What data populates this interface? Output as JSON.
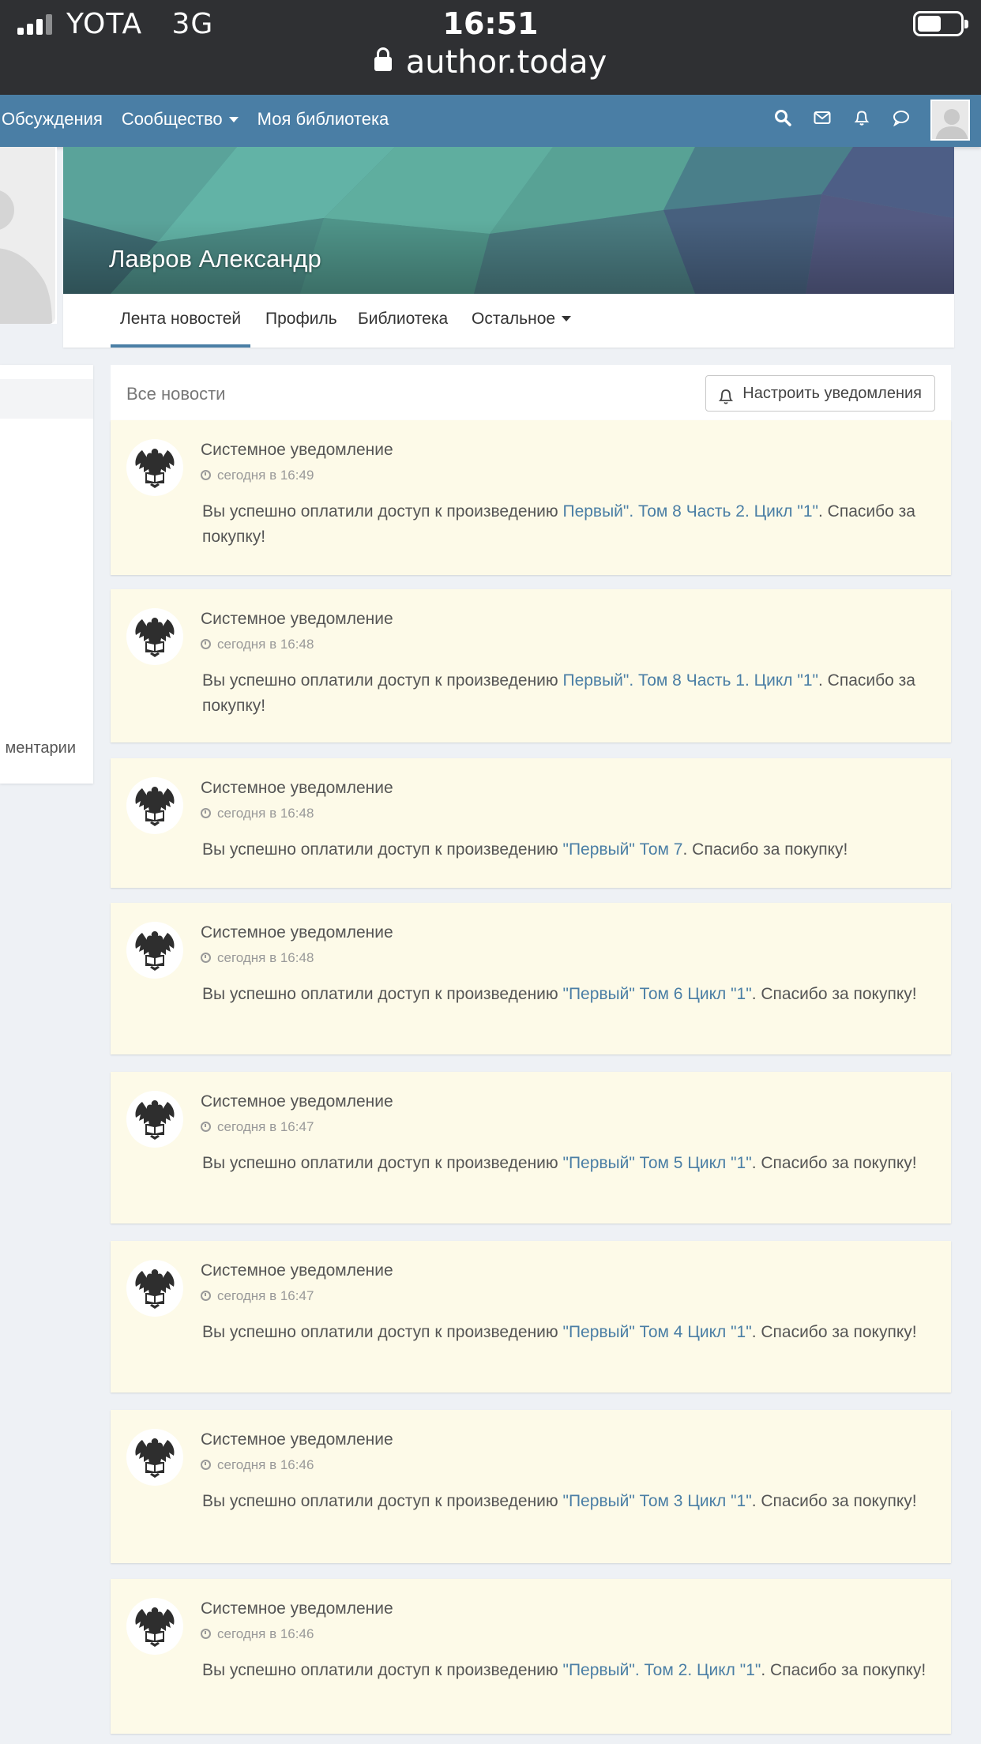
{
  "status_bar": {
    "carrier": "YOTA",
    "network": "3G",
    "time": "16:51",
    "url": "author.today"
  },
  "nav": {
    "links": [
      "Обсуждения",
      "Сообщество",
      "Моя библиотека"
    ]
  },
  "profile": {
    "name": "Лавров Александр",
    "tabs": [
      "Лента новостей",
      "Профиль",
      "Библиотека",
      "Остальное"
    ],
    "active_tab": "Лента новостей"
  },
  "left_panel": {
    "comments_label": "ментарии"
  },
  "feed": {
    "title": "Все новости",
    "notify_button": "Настроить уведомления",
    "items": [
      {
        "author": "Системное уведомление",
        "time": "сегодня в 16:49",
        "prefix": "Вы успешно оплатили доступ к произведению ",
        "link": "Первый\". Том 8 Часть 2. Цикл \"1\"",
        "suffix": ". Спасибо за покупку!"
      },
      {
        "author": "Системное уведомление",
        "time": "сегодня в 16:48",
        "prefix": "Вы успешно оплатили доступ к произведению ",
        "link": "Первый\". Том 8 Часть 1. Цикл \"1\"",
        "suffix": ". Спасибо за покупку!"
      },
      {
        "author": "Системное уведомление",
        "time": "сегодня в 16:48",
        "prefix": "Вы успешно оплатили доступ к произведению ",
        "link": "\"Первый\" Том 7",
        "suffix": ". Спасибо за покупку!"
      },
      {
        "author": "Системное уведомление",
        "time": "сегодня в 16:48",
        "prefix": "Вы успешно оплатили доступ к произведению ",
        "link": "\"Первый\" Том 6 Цикл \"1\"",
        "suffix": ". Спасибо за покупку!"
      },
      {
        "author": "Системное уведомление",
        "time": "сегодня в 16:47",
        "prefix": "Вы успешно оплатили доступ к произведению ",
        "link": "\"Первый\" Том 5 Цикл \"1\"",
        "suffix": ". Спасибо за покупку!"
      },
      {
        "author": "Системное уведомление",
        "time": "сегодня в 16:47",
        "prefix": "Вы успешно оплатили доступ к произведению ",
        "link": "\"Первый\" Том 4 Цикл \"1\"",
        "suffix": ". Спасибо за покупку!"
      },
      {
        "author": "Системное уведомление",
        "time": "сегодня в 16:46",
        "prefix": "Вы успешно оплатили доступ к произведению ",
        "link": "\"Первый\" Том 3 Цикл \"1\"",
        "suffix": ". Спасибо за покупку!"
      },
      {
        "author": "Системное уведомление",
        "time": "сегодня в 16:46",
        "prefix": "Вы успешно оплатили доступ к произведению ",
        "link": "\"Первый\". Том 2. Цикл \"1\"",
        "suffix": ". Спасибо за покупку!"
      }
    ]
  }
}
